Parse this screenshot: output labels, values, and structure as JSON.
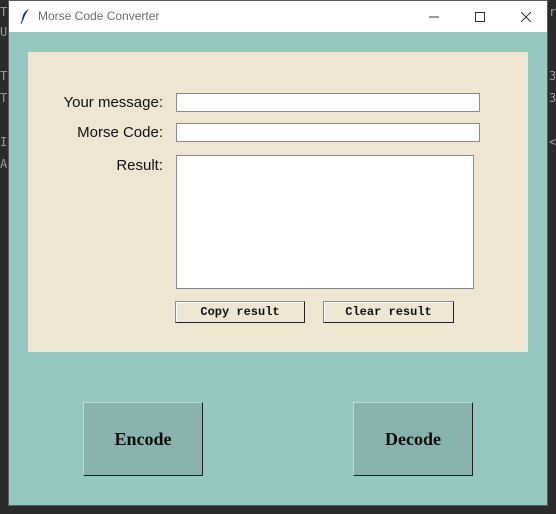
{
  "background": {
    "left_chars": [
      "T",
      "U",
      "T",
      "T",
      "I",
      "A"
    ],
    "right_chars": [
      "r",
      "3",
      "3",
      "<"
    ]
  },
  "window": {
    "title": "Morse Code Converter",
    "icon": "feather-icon",
    "controls": [
      "minimize-icon",
      "maximize-icon",
      "close-icon"
    ]
  },
  "form": {
    "message_label": "Your message:",
    "message_value": "",
    "morse_label": "Morse Code:",
    "morse_value": "",
    "result_label": "Result:",
    "result_value": ""
  },
  "buttons": {
    "copy": "Copy result",
    "clear": "Clear result",
    "encode": "Encode",
    "decode": "Decode"
  },
  "colors": {
    "window_bg": "#96c8c2",
    "panel_bg": "#eee6d3",
    "big_button_bg": "#88b3ae"
  }
}
